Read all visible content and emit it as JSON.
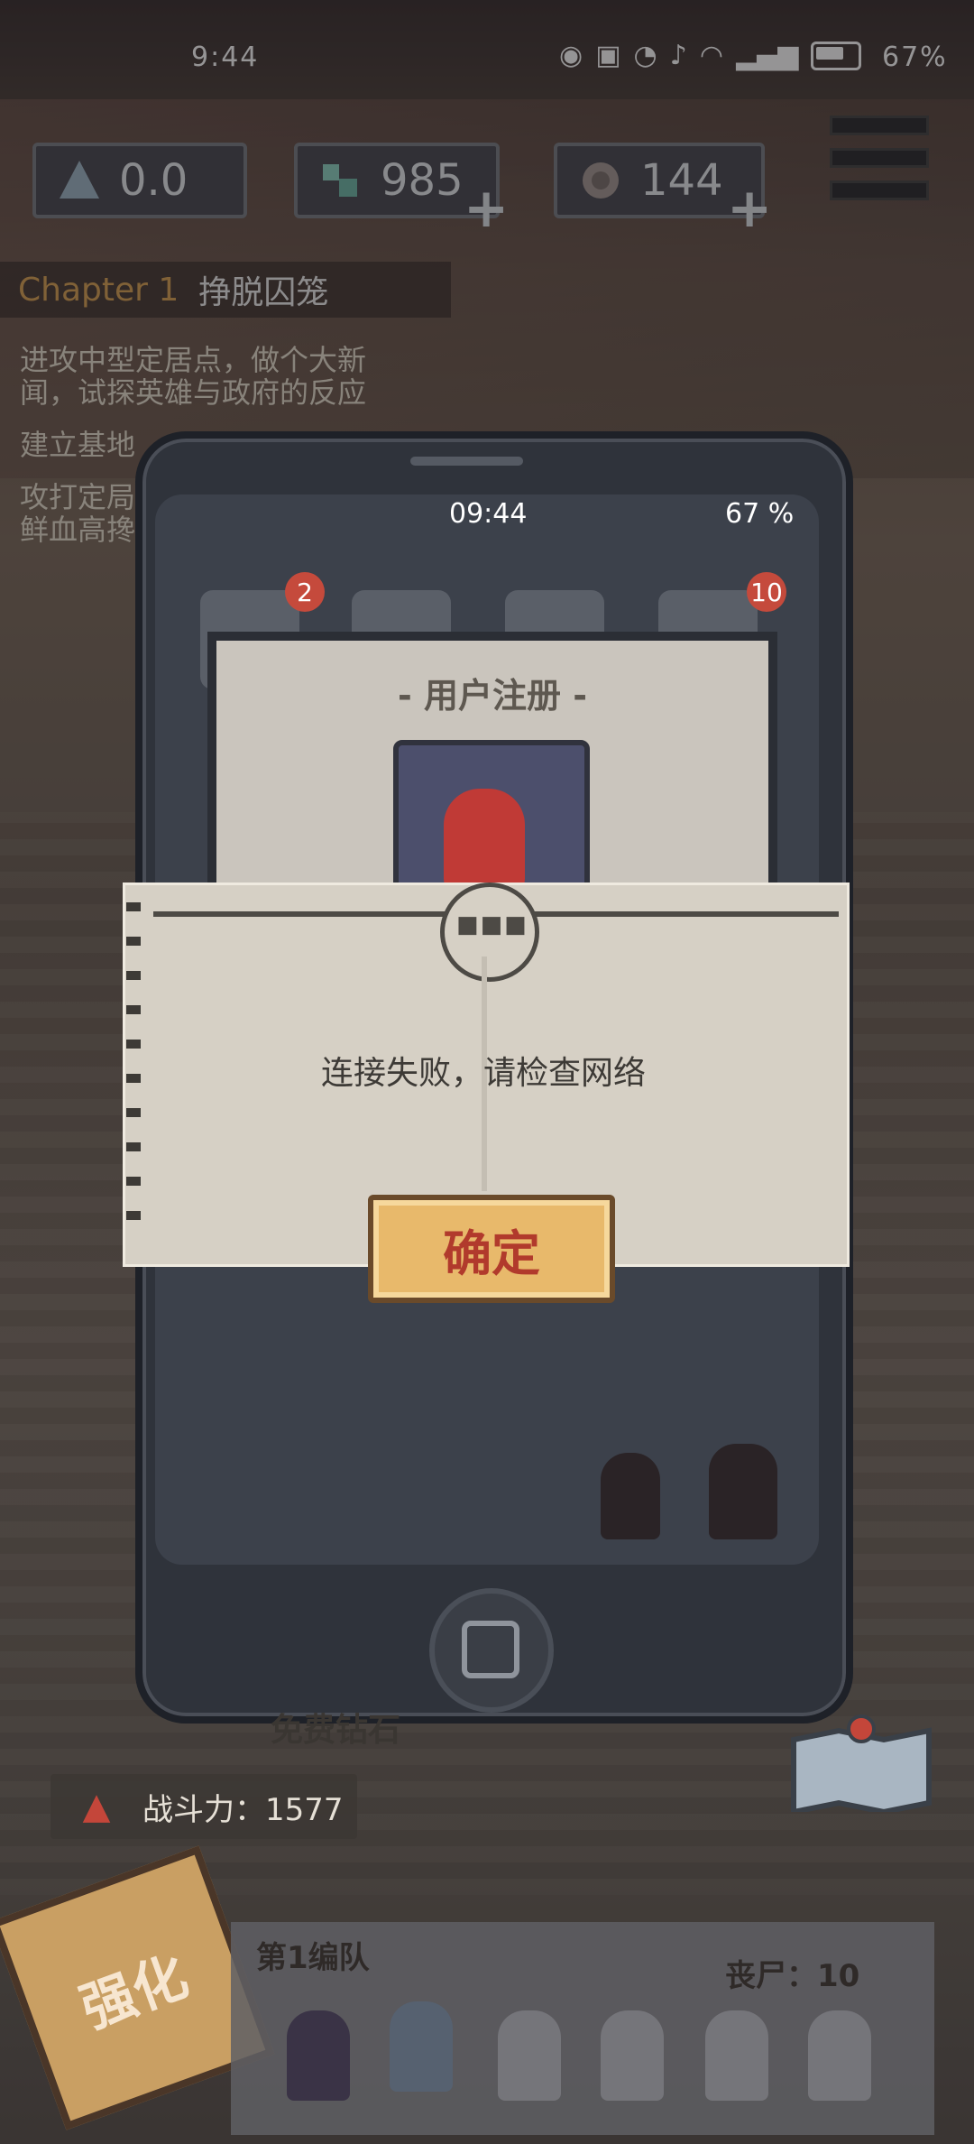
{
  "status_bar": {
    "time": "9:44",
    "battery_pct": "67%"
  },
  "resources": {
    "energy": "0.0",
    "gems": "985",
    "coins": "144"
  },
  "chapter": {
    "number": "Chapter 1",
    "title": "挣脱囚笼"
  },
  "quests": [
    "进攻中型定居点，做个大新",
    "闻，试探英雄与政府的反应",
    "建立基地",
    "攻打定局",
    "鲜血高搀"
  ],
  "phone": {
    "time": "09:44",
    "battery": "67 %",
    "badges": [
      "2",
      "10"
    ],
    "register_title": "- 用户注册 -"
  },
  "dialog": {
    "message": "连接失败，请检查网络",
    "confirm_label": "确定"
  },
  "hud": {
    "free_gems": "免费钻石",
    "power": "战斗力：1577",
    "strengthen": "强化",
    "team_name": "第1编队",
    "zombies": "丧尸：10"
  }
}
